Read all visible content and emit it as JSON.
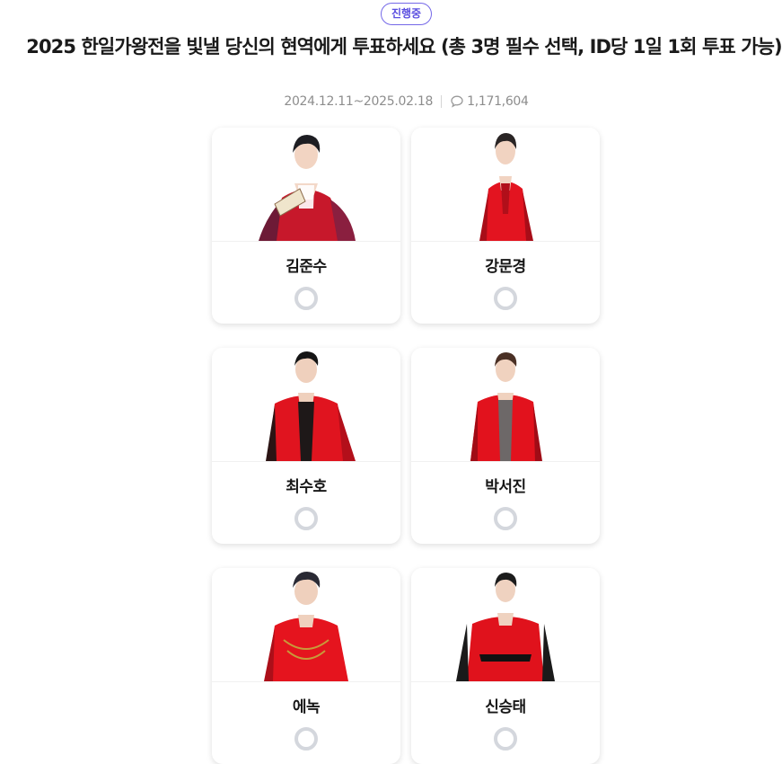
{
  "poll": {
    "status": "진행중",
    "title": "2025 한일가왕전을 빛낼 당신의 현역에게 투표하세요 (총 3명 필수 선택, ID당 1일 1회 투표 가능)",
    "period": "2024.12.11~2025.02.18",
    "comment_count": "1,171,604"
  },
  "candidates": [
    {
      "name": "김준수",
      "outfit": "#c7182b"
    },
    {
      "name": "강문경",
      "outfit": "#e31420"
    },
    {
      "name": "최수호",
      "outfit": "#e0141f"
    },
    {
      "name": "박서진",
      "outfit": "#e2121d"
    },
    {
      "name": "에녹",
      "outfit": "#e5141e"
    },
    {
      "name": "신승태",
      "outfit": "#e0121c"
    }
  ],
  "colors": {
    "accent": "#5b4fe0",
    "radio_border": "#d4d7dd",
    "meta_text": "#8d8d8d"
  }
}
